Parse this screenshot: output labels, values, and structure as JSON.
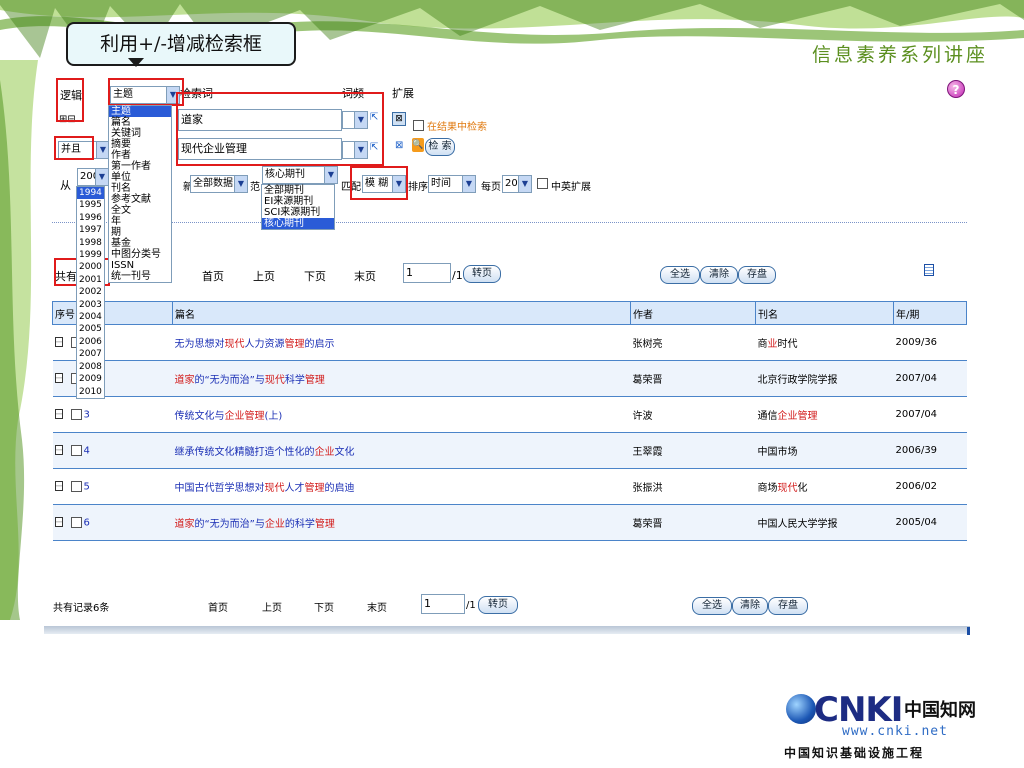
{
  "slide": {
    "callout_text": "利用+/-增减检索框",
    "series_title": "信息素养系列讲座"
  },
  "search": {
    "logic_label": "逻辑",
    "plus_minus": "⊞⊟",
    "logic_value": "并且",
    "field_selected": "主题",
    "field_options": [
      "主题",
      "篇名",
      "关键词",
      "摘要",
      "作者",
      "第一作者",
      "单位",
      "刊名",
      "参考文献",
      "全文",
      "年",
      "期",
      "基金",
      "中图分类号",
      "ISSN",
      "统一刊号"
    ],
    "keyword_label": "检索词",
    "freq_label": "词频",
    "expand_label": "扩展",
    "term1": "道家",
    "term2": "现代企业管理",
    "in_results_label": "在结果中检索",
    "search_button": "检 索",
    "from_label": "从",
    "year_from": "2005",
    "year_options": [
      "1994",
      "1995",
      "1996",
      "1997",
      "1998",
      "1999",
      "2000",
      "2001",
      "2002",
      "2003",
      "2004",
      "2005",
      "2006",
      "2007",
      "2008",
      "2009",
      "2010"
    ],
    "update_label": "新",
    "update_value": "全部数据",
    "range_label": "范",
    "range_value": "核心期刊",
    "range_options": [
      "全部期刊",
      "EI来源期刊",
      "SCI来源期刊",
      "核心期刊"
    ],
    "match_label": "匹配",
    "match_value": "模 糊",
    "sort_label": "排序",
    "sort_value": "时间",
    "per_page_label": "每页",
    "per_page_value": "20",
    "cn_en_label": "中英扩展"
  },
  "pager_top": {
    "count_prefix": "共有",
    "first": "首页",
    "prev": "上页",
    "next": "下页",
    "last": "末页",
    "page_value": "1",
    "page_total": "/1",
    "go_button": "转页",
    "select_all": "全选",
    "clear": "清除",
    "save": "存盘"
  },
  "table": {
    "headers": {
      "no": "序号",
      "title": "篇名",
      "author": "作者",
      "journal": "刊名",
      "issue": "年/期"
    },
    "rows": [
      {
        "no": "1",
        "title": [
          [
            "无为思想对",
            "b"
          ],
          [
            "现代",
            "r"
          ],
          [
            "人力资源",
            "b"
          ],
          [
            "管理",
            "r"
          ],
          [
            "的启示",
            "b"
          ]
        ],
        "author": "张树亮",
        "journal": [
          [
            "商",
            "k"
          ],
          [
            "业",
            "r"
          ],
          [
            "时代",
            "k"
          ]
        ],
        "issue": "2009/36"
      },
      {
        "no": "2",
        "title": [
          [
            "道家",
            "r"
          ],
          [
            "的“无为而治”与",
            "b"
          ],
          [
            "现代",
            "r"
          ],
          [
            "科学",
            "b"
          ],
          [
            "管理",
            "r"
          ]
        ],
        "author": "葛荣晋",
        "journal": [
          [
            "北京行政学院学报",
            "k"
          ]
        ],
        "issue": "2007/04"
      },
      {
        "no": "3",
        "title": [
          [
            "传统文化与",
            "b"
          ],
          [
            "企业管理",
            "r"
          ],
          [
            "(上)",
            "b"
          ]
        ],
        "author": "许波",
        "journal": [
          [
            "通信",
            "k"
          ],
          [
            "企业管理",
            "r"
          ]
        ],
        "issue": "2007/04"
      },
      {
        "no": "4",
        "title": [
          [
            "继承传统文化精髓打造个性化的",
            "b"
          ],
          [
            "企业",
            "r"
          ],
          [
            "文化",
            "b"
          ]
        ],
        "author": "王翠霞",
        "journal": [
          [
            "中国市场",
            "k"
          ]
        ],
        "issue": "2006/39"
      },
      {
        "no": "5",
        "title": [
          [
            "中国古代哲学思想对",
            "b"
          ],
          [
            "现代",
            "r"
          ],
          [
            "人才",
            "b"
          ],
          [
            "管理",
            "r"
          ],
          [
            "的启迪",
            "b"
          ]
        ],
        "author": "张振洪",
        "journal": [
          [
            "商场",
            "k"
          ],
          [
            "现代",
            "r"
          ],
          [
            "化",
            "k"
          ]
        ],
        "issue": "2006/02"
      },
      {
        "no": "6",
        "title": [
          [
            "道家",
            "r"
          ],
          [
            "的“无为而治”与",
            "b"
          ],
          [
            "企业",
            "r"
          ],
          [
            "的科学",
            "b"
          ],
          [
            "管理",
            "r"
          ]
        ],
        "author": "葛荣晋",
        "journal": [
          [
            "中国人民大学学报",
            "k"
          ]
        ],
        "issue": "2005/04"
      }
    ]
  },
  "pager_bottom": {
    "count_text": "共有记录6条",
    "first": "首页",
    "prev": "上页",
    "next": "下页",
    "last": "末页",
    "page_value": "1",
    "page_total": "/1",
    "go_button": "转页",
    "select_all": "全选",
    "clear": "清除",
    "save": "存盘"
  },
  "logo": {
    "brand": "CNKI",
    "brand_cn": "中国知网",
    "url": "www.cnki.net",
    "subtitle": "中国知识基础设施工程"
  },
  "colors": {
    "accent": "#4b84c9",
    "highlight_red": "#e01b1b",
    "link_blue": "#1b2fb5",
    "keyword_red": "#d21b1b"
  }
}
